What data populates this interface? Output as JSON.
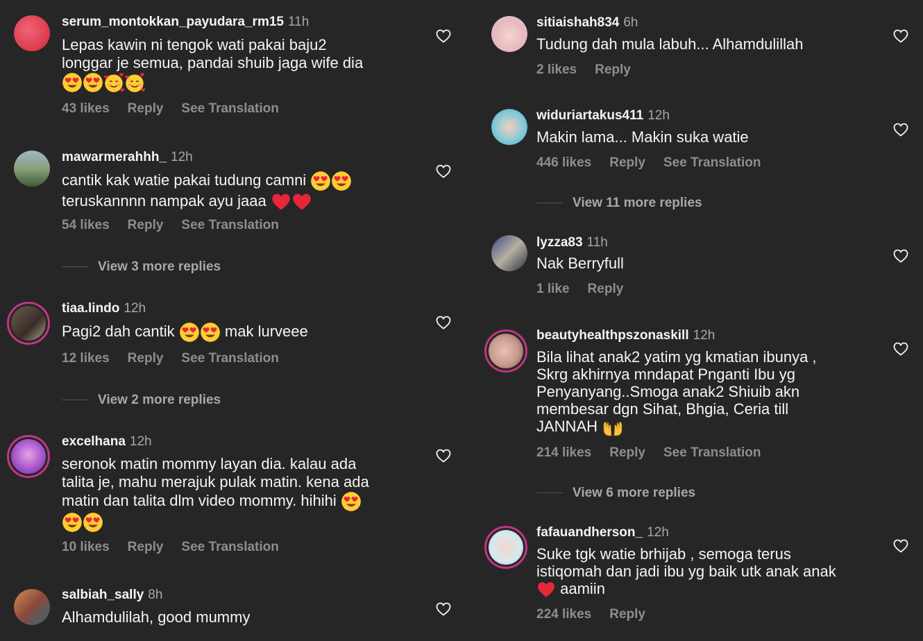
{
  "accent_color": "#c13584",
  "left_comments": [
    {
      "username": "serum_montokkan_payudara_rm15",
      "time": "11h",
      "text": "Lepas kawin ni tengok wati pakai baju2\nlonggar je semua, pandai shuib jaga wife dia",
      "likes": "43 likes",
      "reply": "Reply",
      "translation": "See Translation"
    },
    {
      "username": "mawarmerahhh_",
      "time": "12h",
      "text": "cantik kak watie pakai tudung camni",
      "text2": "teruskannnn nampak ayu jaaa",
      "likes": "54 likes",
      "reply": "Reply",
      "translation": "See Translation",
      "view_more": "View 3 more replies"
    },
    {
      "username": "tiaa.lindo",
      "time": "12h",
      "text": "Pagi2 dah cantik",
      "text_after": "mak lurveee",
      "likes": "12 likes",
      "reply": "Reply",
      "translation": "See Translation",
      "view_more": "View 2 more replies"
    },
    {
      "username": "excelhana",
      "time": "12h",
      "text": "seronok matin mommy layan dia. kalau ada\ntalita je, mahu merajuk pulak matin. kena ada\nmatin dan talita dlm video mommy. hihihi",
      "likes": "10 likes",
      "reply": "Reply",
      "translation": "See Translation"
    },
    {
      "username": "salbiah_sally",
      "time": "8h",
      "text": "Alhamdulilah, good mummy"
    }
  ],
  "right_comments": [
    {
      "username": "sitiaishah834",
      "time": "6h",
      "text": "Tudung dah mula labuh... Alhamdulillah",
      "likes": "2 likes",
      "reply": "Reply"
    },
    {
      "username": "widuriartakus411",
      "time": "12h",
      "text": "Makin lama... Makin suka watie",
      "likes": "446 likes",
      "reply": "Reply",
      "translation": "See Translation",
      "view_more": "View 11 more replies"
    },
    {
      "username": "lyzza83",
      "time": "11h",
      "text": "Nak Berryfull",
      "likes": "1 like",
      "reply": "Reply"
    },
    {
      "username": "beautyhealthpszonaskill",
      "time": "12h",
      "text": "Bila lihat anak2 yatim yg kmatian ibunya ,\nSkrg akhirnya mndapat Pnganti  Ibu yg\nPenyanyang..Smoga anak2 Shiuib akn\nmembesar dgn Sihat, Bhgia, Ceria till",
      "text_last": "JANNAH",
      "likes": "214 likes",
      "reply": "Reply",
      "translation": "See Translation",
      "view_more": "View 6 more replies"
    },
    {
      "username": "fafauandherson_",
      "time": "12h",
      "text": "Suke tgk watie brhijab , semoga terus\nistiqomah dan jadi ibu yg baik utk anak anak",
      "text_last": "aamiin",
      "likes": "224 likes",
      "reply": "Reply"
    }
  ],
  "icons": {
    "like": "heart-outline-icon",
    "emoji_heart_eyes": "heart-eyes-emoji",
    "emoji_smiling_hearts": "smiling-face-with-hearts-emoji",
    "emoji_red_heart": "red-heart-emoji",
    "emoji_palms": "palms-up-emoji"
  }
}
